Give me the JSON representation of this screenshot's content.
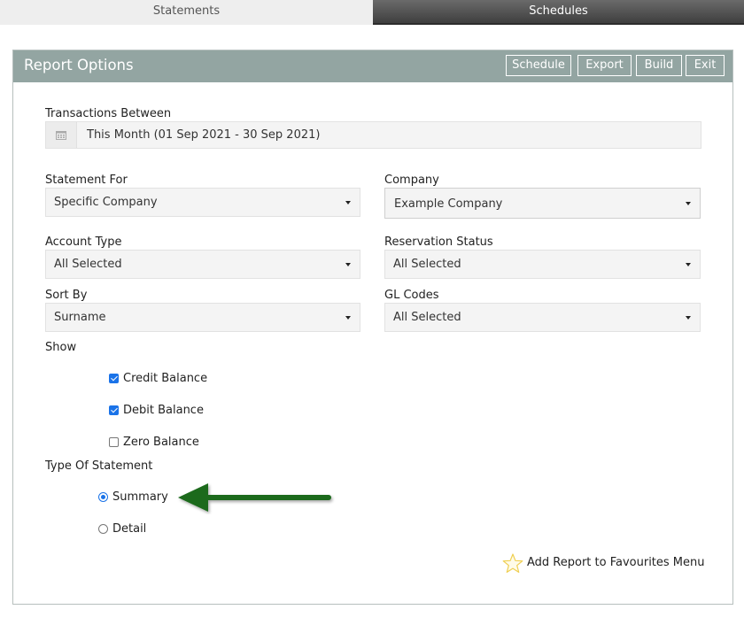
{
  "tabs": [
    {
      "label": "Statements",
      "active": false
    },
    {
      "label": "Schedules",
      "active": true
    }
  ],
  "panel": {
    "title": "Report Options",
    "buttons": {
      "schedule": "Schedule",
      "export": "Export",
      "build": "Build",
      "exit": "Exit"
    }
  },
  "transactions": {
    "label": "Transactions Between",
    "value": "This Month (01 Sep 2021 - 30 Sep 2021)",
    "icon": "calendar-icon"
  },
  "statement_for": {
    "label": "Statement For",
    "value": "Specific Company"
  },
  "company": {
    "label": "Company",
    "value": "Example Company"
  },
  "account_type": {
    "label": "Account Type",
    "value": "All Selected"
  },
  "reservation_status": {
    "label": "Reservation Status",
    "value": "All Selected"
  },
  "sort_by": {
    "label": "Sort By",
    "value": "Surname"
  },
  "gl_codes": {
    "label": "GL Codes",
    "value": "All Selected"
  },
  "show": {
    "label": "Show",
    "options": [
      {
        "label": "Credit Balance",
        "checked": true
      },
      {
        "label": "Debit Balance",
        "checked": true
      },
      {
        "label": "Zero Balance",
        "checked": false
      }
    ]
  },
  "statement_type": {
    "label": "Type Of Statement",
    "options": [
      {
        "label": "Summary",
        "selected": true
      },
      {
        "label": "Detail",
        "selected": false
      }
    ]
  },
  "favourites": {
    "label": "Add Report to Favourites Menu",
    "icon": "star-icon"
  },
  "colors": {
    "header": "#93a5a2",
    "active_tab": "#4a4a4a",
    "accent": "#1a73e8",
    "arrow": "#1e6b1e",
    "star": "#f2d25a"
  }
}
